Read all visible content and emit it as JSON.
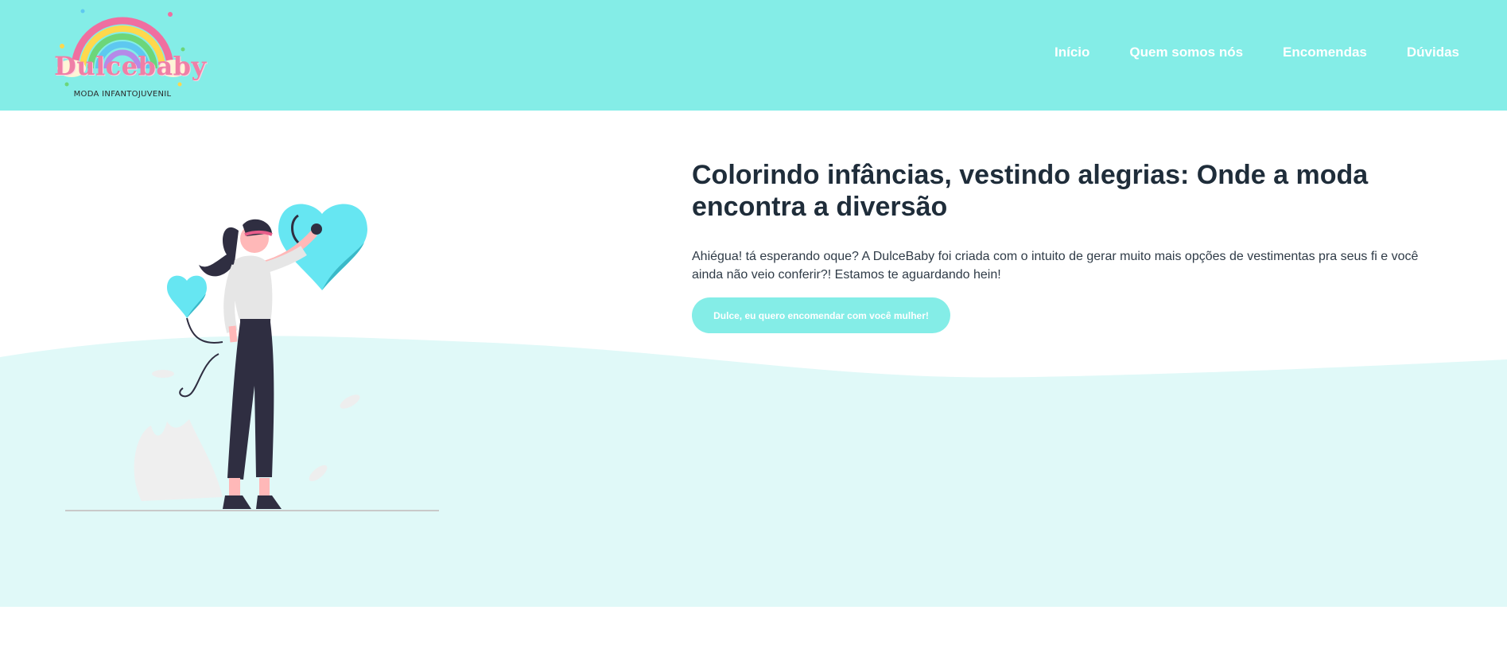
{
  "brand": {
    "name": "Dulcebaby",
    "tagline": "MODA INFANTOJUVENIL"
  },
  "nav": {
    "items": [
      {
        "label": "Início"
      },
      {
        "label": "Quem somos nós"
      },
      {
        "label": "Encomendas"
      },
      {
        "label": "Dúvidas"
      }
    ]
  },
  "hero": {
    "headline": "Colorindo infâncias, vestindo alegrias: Onde a moda encontra a diversão",
    "paragraph": "Ahiégua! tá esperando oque? A DulceBaby foi criada com o intuito de gerar muito mais opções de vestimentas pra seus fi e você ainda não veio conferir?! Estamos te aguardando hein!",
    "cta_label": "Dulce, eu quero encomendar com você mulher!",
    "illustration_icon": "woman-with-heart-balloons-illustration"
  },
  "colors": {
    "header_bg": "#84ede7",
    "hero_wave": "#e0f9f8",
    "accent": "#84ede7",
    "heading": "#1f2d3a",
    "logo_pink": "#ef7fa6"
  }
}
